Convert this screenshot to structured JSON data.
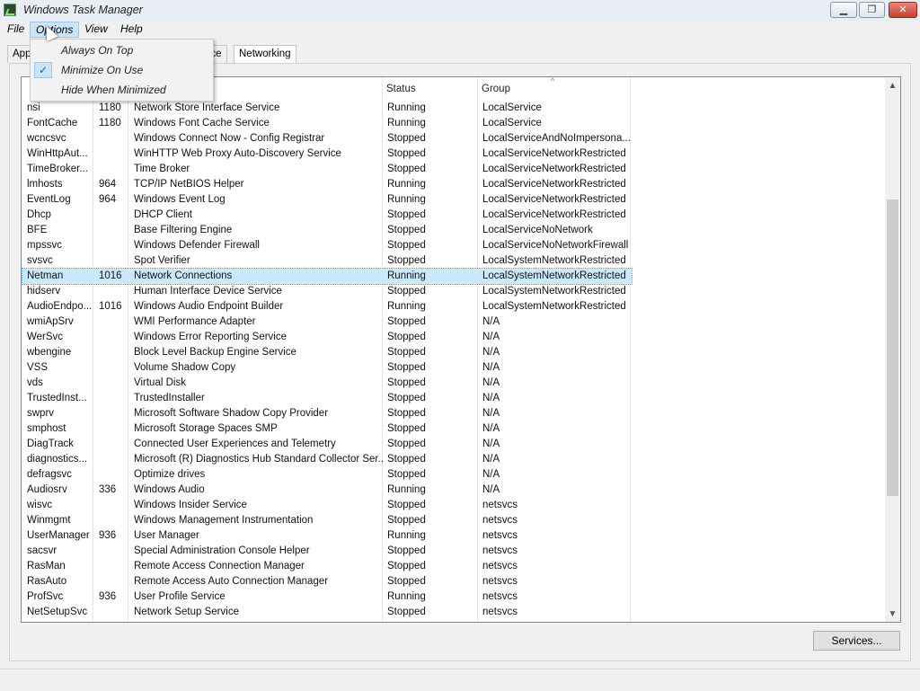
{
  "window": {
    "title": "Windows Task Manager",
    "controls": {
      "minimize": "▁",
      "maximize": "❐",
      "close": "✕"
    }
  },
  "menu": [
    "File",
    "Options",
    "View",
    "Help"
  ],
  "tabs": [
    "App",
    "nce",
    "Networking"
  ],
  "options_menu": {
    "items": [
      {
        "label": "Always On Top",
        "checked": false
      },
      {
        "label": "Minimize On Use",
        "checked": true
      },
      {
        "label": "Hide When Minimized",
        "checked": false
      }
    ]
  },
  "columns": {
    "status": "Status",
    "group": "Group",
    "sort_indicator": "^"
  },
  "services": [
    {
      "name": "nsi",
      "pid": "1180",
      "description": "Network Store Interface Service",
      "status": "Running",
      "group": "LocalService"
    },
    {
      "name": "FontCache",
      "pid": "1180",
      "description": "Windows Font Cache Service",
      "status": "Running",
      "group": "LocalService"
    },
    {
      "name": "wcncsvc",
      "pid": "",
      "description": "Windows Connect Now - Config Registrar",
      "status": "Stopped",
      "group": "LocalServiceAndNoImpersona..."
    },
    {
      "name": "WinHttpAut...",
      "pid": "",
      "description": "WinHTTP Web Proxy Auto-Discovery Service",
      "status": "Stopped",
      "group": "LocalServiceNetworkRestricted"
    },
    {
      "name": "TimeBroker...",
      "pid": "",
      "description": "Time Broker",
      "status": "Stopped",
      "group": "LocalServiceNetworkRestricted"
    },
    {
      "name": "lmhosts",
      "pid": "964",
      "description": "TCP/IP NetBIOS Helper",
      "status": "Running",
      "group": "LocalServiceNetworkRestricted"
    },
    {
      "name": "EventLog",
      "pid": "964",
      "description": "Windows Event Log",
      "status": "Running",
      "group": "LocalServiceNetworkRestricted"
    },
    {
      "name": "Dhcp",
      "pid": "",
      "description": "DHCP Client",
      "status": "Stopped",
      "group": "LocalServiceNetworkRestricted"
    },
    {
      "name": "BFE",
      "pid": "",
      "description": "Base Filtering Engine",
      "status": "Stopped",
      "group": "LocalServiceNoNetwork"
    },
    {
      "name": "mpssvc",
      "pid": "",
      "description": "Windows Defender Firewall",
      "status": "Stopped",
      "group": "LocalServiceNoNetworkFirewall"
    },
    {
      "name": "svsvc",
      "pid": "",
      "description": "Spot Verifier",
      "status": "Stopped",
      "group": "LocalSystemNetworkRestricted"
    },
    {
      "name": "Netman",
      "pid": "1016",
      "description": "Network Connections",
      "status": "Running",
      "group": "LocalSystemNetworkRestricted",
      "selected": true
    },
    {
      "name": "hidserv",
      "pid": "",
      "description": "Human Interface Device Service",
      "status": "Stopped",
      "group": "LocalSystemNetworkRestricted"
    },
    {
      "name": "AudioEndpo...",
      "pid": "1016",
      "description": "Windows Audio Endpoint Builder",
      "status": "Running",
      "group": "LocalSystemNetworkRestricted"
    },
    {
      "name": "wmiApSrv",
      "pid": "",
      "description": "WMI Performance Adapter",
      "status": "Stopped",
      "group": "N/A"
    },
    {
      "name": "WerSvc",
      "pid": "",
      "description": "Windows Error Reporting Service",
      "status": "Stopped",
      "group": "N/A"
    },
    {
      "name": "wbengine",
      "pid": "",
      "description": "Block Level Backup Engine Service",
      "status": "Stopped",
      "group": "N/A"
    },
    {
      "name": "VSS",
      "pid": "",
      "description": "Volume Shadow Copy",
      "status": "Stopped",
      "group": "N/A"
    },
    {
      "name": "vds",
      "pid": "",
      "description": "Virtual Disk",
      "status": "Stopped",
      "group": "N/A"
    },
    {
      "name": "TrustedInst...",
      "pid": "",
      "description": "TrustedInstaller",
      "status": "Stopped",
      "group": "N/A"
    },
    {
      "name": "swprv",
      "pid": "",
      "description": "Microsoft Software Shadow Copy Provider",
      "status": "Stopped",
      "group": "N/A"
    },
    {
      "name": "smphost",
      "pid": "",
      "description": "Microsoft Storage Spaces SMP",
      "status": "Stopped",
      "group": "N/A"
    },
    {
      "name": "DiagTrack",
      "pid": "",
      "description": "Connected User Experiences and Telemetry",
      "status": "Stopped",
      "group": "N/A"
    },
    {
      "name": "diagnostics...",
      "pid": "",
      "description": "Microsoft (R) Diagnostics Hub Standard Collector Ser...",
      "status": "Stopped",
      "group": "N/A"
    },
    {
      "name": "defragsvc",
      "pid": "",
      "description": "Optimize drives",
      "status": "Stopped",
      "group": "N/A"
    },
    {
      "name": "Audiosrv",
      "pid": "336",
      "description": "Windows Audio",
      "status": "Running",
      "group": "N/A"
    },
    {
      "name": "wisvc",
      "pid": "",
      "description": "Windows Insider Service",
      "status": "Stopped",
      "group": "netsvcs"
    },
    {
      "name": "Winmgmt",
      "pid": "",
      "description": "Windows Management Instrumentation",
      "status": "Stopped",
      "group": "netsvcs"
    },
    {
      "name": "UserManager",
      "pid": "936",
      "description": "User Manager",
      "status": "Running",
      "group": "netsvcs"
    },
    {
      "name": "sacsvr",
      "pid": "",
      "description": "Special Administration Console Helper",
      "status": "Stopped",
      "group": "netsvcs"
    },
    {
      "name": "RasMan",
      "pid": "",
      "description": "Remote Access Connection Manager",
      "status": "Stopped",
      "group": "netsvcs"
    },
    {
      "name": "RasAuto",
      "pid": "",
      "description": "Remote Access Auto Connection Manager",
      "status": "Stopped",
      "group": "netsvcs"
    },
    {
      "name": "ProfSvc",
      "pid": "936",
      "description": "User Profile Service",
      "status": "Running",
      "group": "netsvcs"
    },
    {
      "name": "NetSetupSvc",
      "pid": "",
      "description": "Network Setup Service",
      "status": "Stopped",
      "group": "netsvcs"
    }
  ],
  "buttons": {
    "services": "Services..."
  },
  "scrollbar": {
    "up": "▲",
    "down": "▼"
  }
}
